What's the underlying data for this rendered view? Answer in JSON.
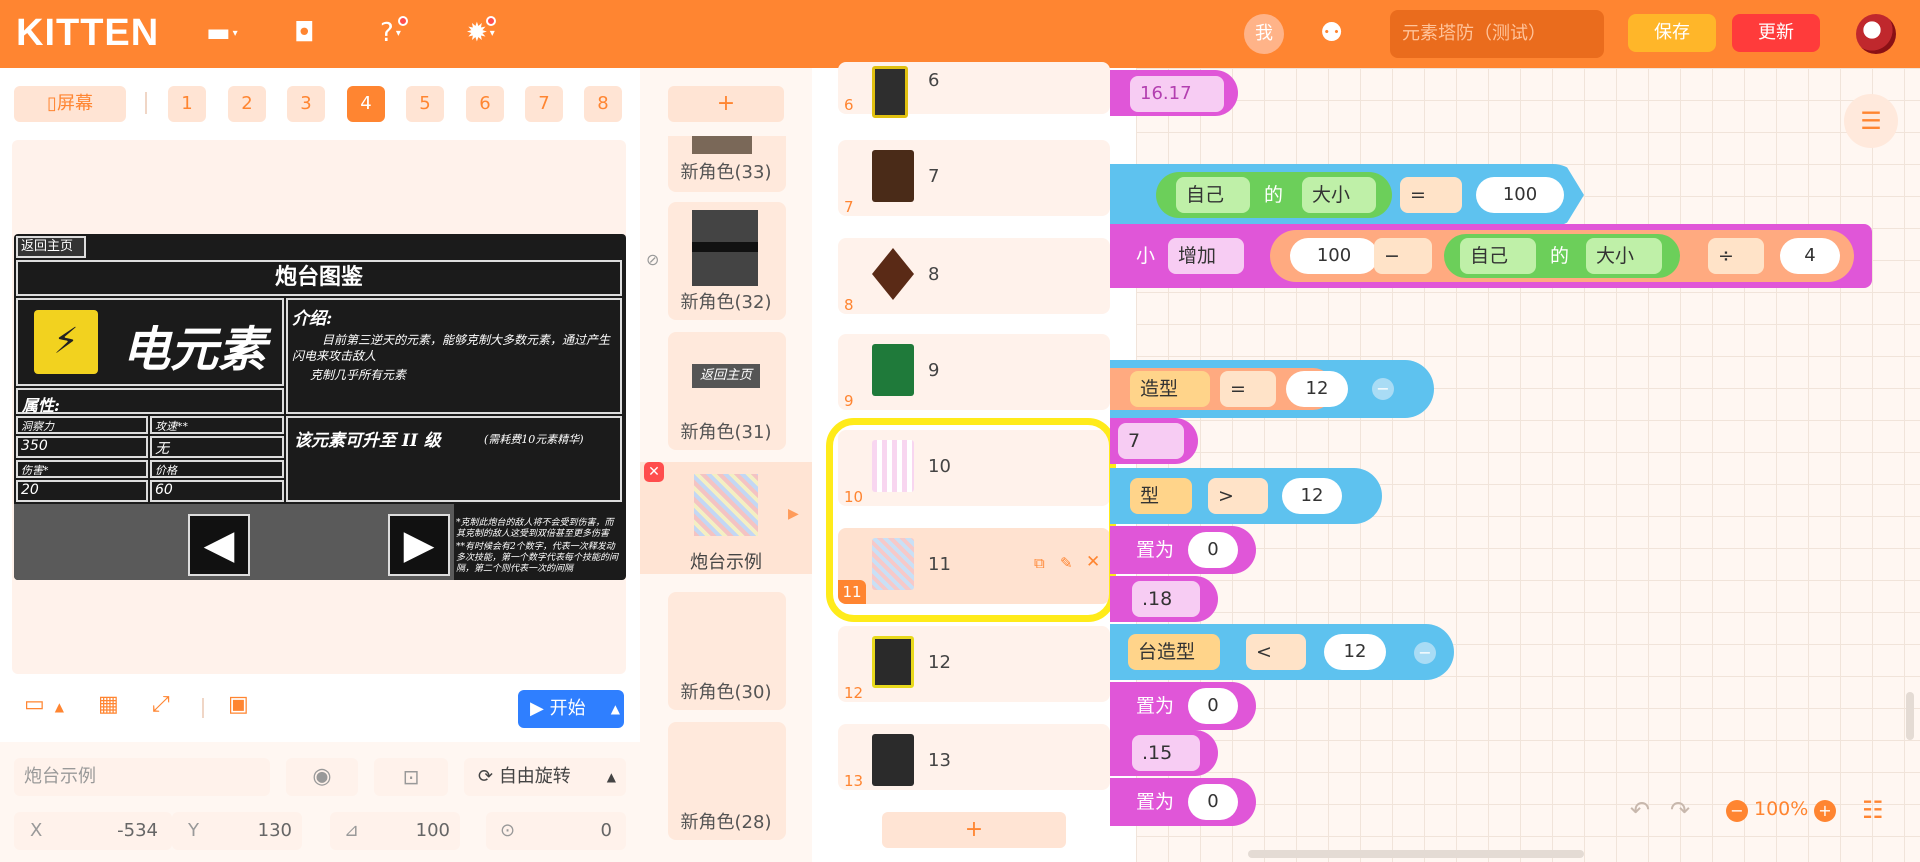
{
  "topbar": {
    "logo": "KITTEN",
    "me": "我",
    "project_name": "元素塔防（测试）",
    "save": "保存",
    "update": "更新"
  },
  "stage_toolbar": {
    "screen_label": "屏幕",
    "screens": [
      "1",
      "2",
      "3",
      "4",
      "5",
      "6",
      "7",
      "8"
    ],
    "active_screen": "4"
  },
  "game": {
    "back": "返回主页",
    "title": "炮台图鉴",
    "element": "电元素",
    "intro_label": "介绍:",
    "intro_text_1": "目前第三逆天的元素，能够克制大多数元素，通过产生闪电来攻击敌人",
    "intro_text_2": "克制几乎所有元素",
    "attr_label": "属性:",
    "stats": [
      {
        "k": "洞察力",
        "v": "350"
      },
      {
        "k": "攻速**",
        "v": "无"
      },
      {
        "k": "伤害*",
        "v": "20"
      },
      {
        "k": "价格",
        "v": "60"
      }
    ],
    "upgrade": "该元素可升至 II 级",
    "upgrade_note": "(需耗费10元素精华)",
    "note_1": "*克制此炮台的敌人将不会受到伤害，而其克制的敌人这受到双倍甚至更多伤害",
    "note_2": "**有时候会有2个数字，代表一次释发动多次技能，第一个数字代表每个技能的间隔，第二个则代表一次的间隔"
  },
  "stage_controls": {
    "start": "开始"
  },
  "sprite_props": {
    "name": "炮台示例",
    "rotation": "自由旋转",
    "x_label": "X",
    "x": "-534",
    "y_label": "Y",
    "y": "130",
    "size": "100",
    "direction": "0"
  },
  "sprites": {
    "add": "+",
    "items": [
      "新角色(33)",
      "新角色(32)",
      "新角色(31)",
      "炮台示例",
      "新角色(30)",
      "新角色(28)"
    ],
    "thumb_31_label": "返回主页"
  },
  "costumes": {
    "add": "+",
    "items": [
      "6",
      "7",
      "8",
      "9",
      "10",
      "11",
      "12",
      "13"
    ]
  },
  "code": {
    "top_value": "16.17",
    "b1": {
      "self": "自己",
      "of": "的",
      "size": "大小",
      "op": "=",
      "value": "100"
    },
    "b2": {
      "lead": "小",
      "action": "增加",
      "value": "100",
      "minus": "−",
      "self": "自己",
      "of": "的",
      "size": "大小",
      "div": "÷",
      "divisor": "4"
    },
    "b3": {
      "lead": "造型",
      "op": "=",
      "value": "12"
    },
    "b4": "7",
    "b5": {
      "lead": "型",
      "op": ">",
      "value": "12"
    },
    "b6": {
      "lead": "置为",
      "value": "0"
    },
    "b7": ".18",
    "b8": {
      "lead": "台造型",
      "op": "<",
      "value": "12"
    },
    "b9": {
      "lead": "置为",
      "value": "0"
    },
    "b10": ".15",
    "b11": {
      "lead": "置为",
      "value": "0"
    }
  },
  "zoom": {
    "value": "100%"
  }
}
